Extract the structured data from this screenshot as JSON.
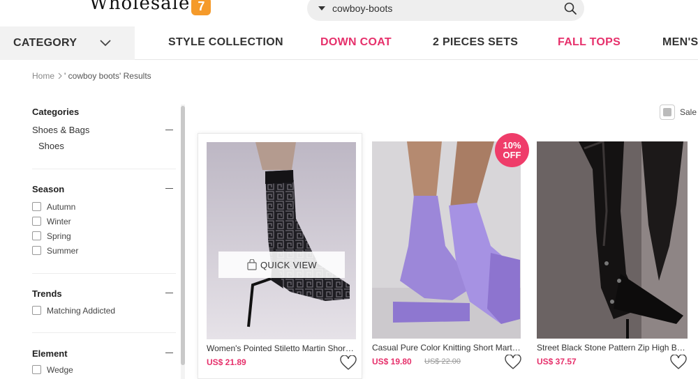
{
  "header": {
    "logo_text": "Wholesale",
    "logo_badge": "7",
    "search_query": "cowboy-boots"
  },
  "nav": {
    "category_label": "CATEGORY",
    "items": [
      {
        "label": "STYLE COLLECTION",
        "color": "#333333"
      },
      {
        "label": "DOWN COAT",
        "color": "#e6306b"
      },
      {
        "label": "2 PIECES SETS",
        "color": "#333333"
      },
      {
        "label": "FALL TOPS",
        "color": "#e6306b"
      },
      {
        "label": "MEN'S",
        "color": "#333333"
      }
    ]
  },
  "breadcrumb": {
    "home": "Home",
    "results": "' cowboy boots'  Results"
  },
  "sidebar": {
    "categories": {
      "title": "Categories",
      "parent": "Shoes & Bags",
      "child": "Shoes"
    },
    "season": {
      "title": "Season",
      "options": [
        "Autumn",
        "Winter",
        "Spring",
        "Summer"
      ]
    },
    "trends": {
      "title": "Trends",
      "options": [
        "Matching Addicted"
      ]
    },
    "element": {
      "title": "Element",
      "options": [
        "Wedge"
      ]
    }
  },
  "sale_label": "Sale",
  "products": [
    {
      "title": "Women's Pointed Stiletto Martin Short ...",
      "price": "US$ 21.89",
      "quick_view": "QUICK VIEW"
    },
    {
      "title": "Casual Pure Color Knitting Short Martin ...",
      "price": "US$ 19.80",
      "old_price": "US$ 22.00",
      "badge_pct": "10%",
      "badge_off": "OFF"
    },
    {
      "title": "Street Black Stone Pattern Zip High Boots",
      "price": "US$ 37.57"
    }
  ],
  "colors": {
    "accent": "#e6306b",
    "badge": "#ef3d6a",
    "logo_badge": "#f59a2a"
  }
}
